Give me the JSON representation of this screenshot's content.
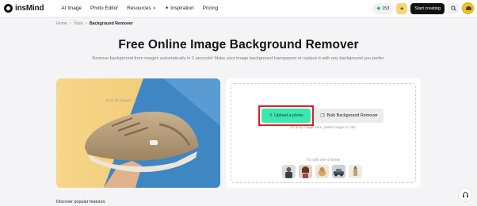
{
  "header": {
    "logo_text": "insMind",
    "nav": [
      {
        "label": "AI Image"
      },
      {
        "label": "Photo Editor"
      },
      {
        "label": "Resources"
      },
      {
        "label": "Inspiration"
      },
      {
        "label": "Pricing"
      }
    ],
    "credits": "153",
    "start_button": "Start creating"
  },
  "breadcrumb": {
    "items": [
      "Home",
      "Tools"
    ],
    "current": "Background Remover"
  },
  "hero": {
    "title": "Free Online Image Background Remover",
    "subtitle": "Remove background from images automatically in 2 seconds! Make your image background transparent or replace it with any background you prefer."
  },
  "upload": {
    "limit_note": "up to 30 images",
    "upload_button": "Upload a photo",
    "bulk_button": "Bulk Background Remover",
    "drop_hint": "Or drop image here, paste image or URL",
    "try_label": "Try with one of these"
  },
  "sample_thumbnails": [
    "person-sample",
    "woman-sample",
    "dog-sample",
    "car-sample",
    "product-sample"
  ],
  "footer": {
    "discover": "Discover popular features"
  },
  "colors": {
    "accent": "#3be8b0",
    "highlight": "#e01e24",
    "primary_dark": "#111111"
  }
}
